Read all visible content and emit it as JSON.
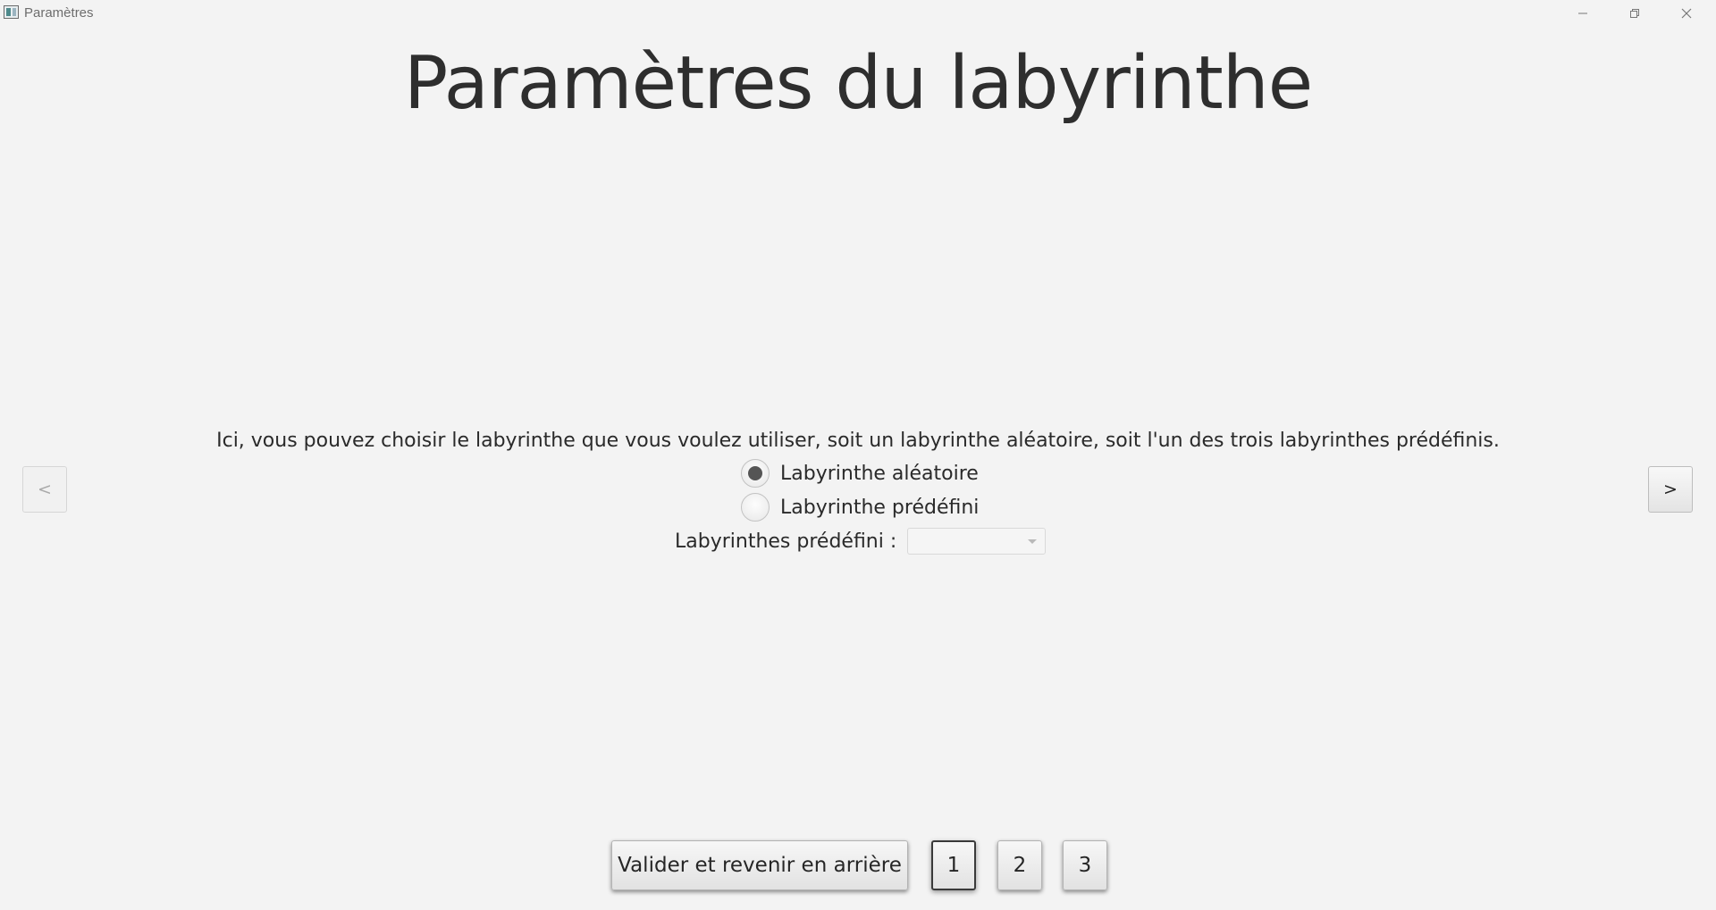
{
  "window": {
    "title": "Paramètres"
  },
  "page": {
    "title": "Paramètres du labyrinthe",
    "description": "Ici, vous pouvez choisir le labyrinthe que vous voulez utiliser, soit un labyrinthe aléatoire, soit l'un des trois labyrinthes prédéfinis."
  },
  "navigation": {
    "prev_label": "<",
    "next_label": ">",
    "prev_enabled": false
  },
  "options": {
    "radios": [
      {
        "label": "Labyrinthe aléatoire",
        "checked": true
      },
      {
        "label": "Labyrinthe prédéfini",
        "checked": false
      }
    ],
    "combo_label": "Labyrinthes prédéfini :",
    "combo_value": ""
  },
  "footer": {
    "validate_label": "Valider et revenir en arrière",
    "pages": [
      "1",
      "2",
      "3"
    ],
    "current_page": "1"
  },
  "colors": {
    "background": "#f3f3f3",
    "text": "#2b2b2b",
    "radio_dot": "#555555"
  },
  "icons": {
    "minimize": "minimize-icon",
    "maximize": "restore-icon",
    "close": "close-icon",
    "app": "app-icon",
    "combo_arrow": "chevron-down-icon"
  }
}
